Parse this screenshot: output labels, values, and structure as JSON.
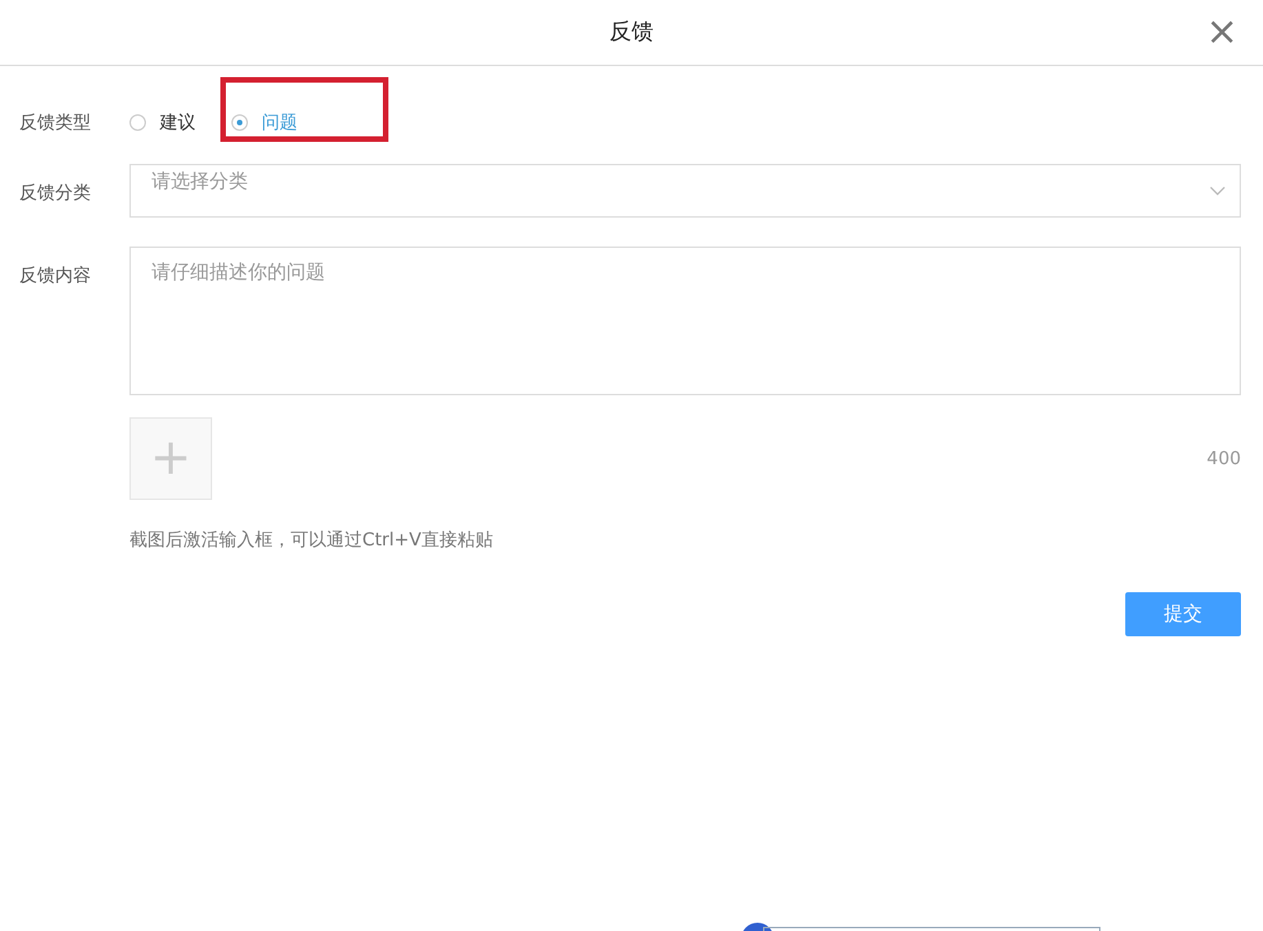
{
  "dialog": {
    "title": "反馈",
    "close": "×"
  },
  "form": {
    "type_label": "反馈类型",
    "type_options": [
      {
        "label": "建议",
        "selected": false
      },
      {
        "label": "问题",
        "selected": true
      }
    ],
    "category_label": "反馈分类",
    "category": {
      "placeholder": "请选择分类"
    },
    "content_label": "反馈内容",
    "content": {
      "placeholder": "请仔细描述你的问题"
    },
    "upload": "+",
    "char_count": "400",
    "hint": "截图后激活输入框，可以通过Ctrl+V直接粘贴"
  },
  "submit": "提交"
}
